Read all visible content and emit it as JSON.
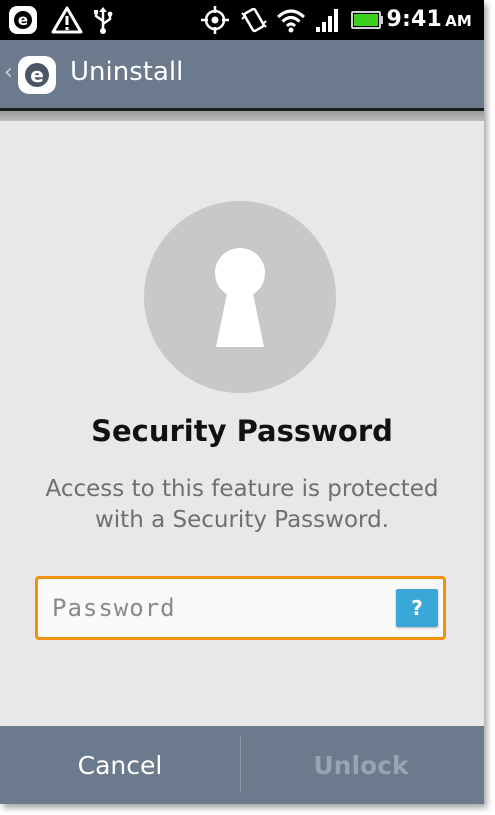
{
  "status_bar": {
    "time": "9:41",
    "ampm": "AM",
    "icons": [
      "eset-icon",
      "warning-icon",
      "usb-icon",
      "gps-icon",
      "vibrate-icon",
      "wifi-icon",
      "signal-icon",
      "battery-icon"
    ]
  },
  "action_bar": {
    "title": "Uninstall"
  },
  "content": {
    "heading": "Security Password",
    "description": "Access to this feature is protected with a Security Password.",
    "password_placeholder": "Password",
    "password_value": "",
    "help_label": "?"
  },
  "bottom_bar": {
    "cancel_label": "Cancel",
    "unlock_label": "Unlock"
  },
  "colors": {
    "action_bar_bg": "#6b7a8d",
    "input_border": "#f0920f",
    "help_button": "#3aa7d9",
    "lock_circle": "#c8c8c8"
  }
}
